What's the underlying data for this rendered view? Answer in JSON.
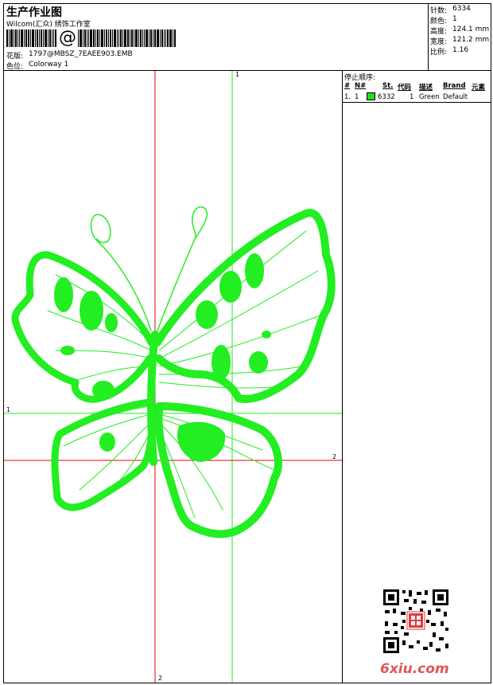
{
  "header": {
    "title": "生产作业图",
    "company": "Wilcom(汇众) 绣饰工作室",
    "barcode_text": "@",
    "design_label": "花版:",
    "design_value": "1797@MBSZ_7EAEE903.EMB",
    "colorway_label": "色位:",
    "colorway_value": "Colorway 1"
  },
  "stats": [
    {
      "label": "针数:",
      "value": "6334"
    },
    {
      "label": "颜色:",
      "value": "1"
    },
    {
      "label": "高度:",
      "value": "124.1 mm"
    },
    {
      "label": "宽度:",
      "value": "121.2 mm"
    },
    {
      "label": "比例:",
      "value": "1.16"
    }
  ],
  "stop_sequence": {
    "title": "停止顺序:",
    "columns": [
      "#",
      "N#",
      "St.",
      "代码",
      "描述",
      "Brand",
      "元素"
    ],
    "rows": [
      {
        "index": "1.",
        "needle": "1",
        "stitches": "6332",
        "code": "1",
        "description": "Green",
        "brand": "Default",
        "color": "#22dd22"
      }
    ]
  },
  "axes": {
    "v1": "1",
    "h1": "1",
    "h2": "2",
    "v2": "2"
  },
  "design_color": "#22ee22",
  "watermark": "6xiu.com"
}
